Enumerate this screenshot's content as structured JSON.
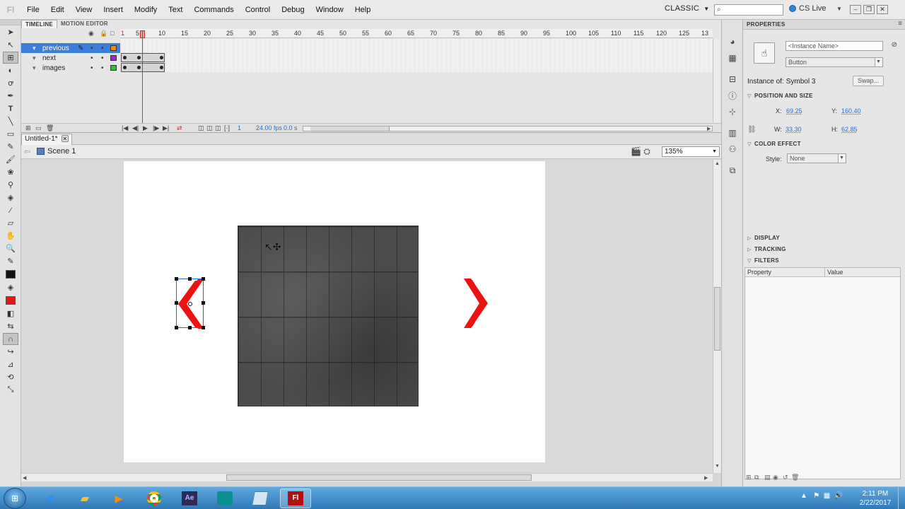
{
  "app": {
    "logo": "Fl"
  },
  "menu": [
    "File",
    "Edit",
    "View",
    "Insert",
    "Modify",
    "Text",
    "Commands",
    "Control",
    "Debug",
    "Window",
    "Help"
  ],
  "workspace": "CLASSIC",
  "search": {
    "placeholder": ""
  },
  "cs_live": "CS Live",
  "timeline": {
    "tabs": [
      "TIMELINE",
      "MOTION EDITOR"
    ],
    "frame_numbers": [
      "1",
      "5",
      "10",
      "15",
      "20",
      "25",
      "30",
      "35",
      "40",
      "45",
      "50",
      "55",
      "60",
      "65",
      "70",
      "75",
      "80",
      "85",
      "90",
      "95",
      "100",
      "105",
      "110",
      "115",
      "120",
      "125",
      "13"
    ],
    "layers": [
      {
        "name": "previous",
        "color": "#ff8000",
        "selected": true
      },
      {
        "name": "next",
        "color": "#a020f0",
        "selected": false
      },
      {
        "name": "images",
        "color": "#22cc22",
        "selected": false
      }
    ],
    "current_frame": "1",
    "fps": "24.00 fps",
    "elapsed": "0.0 s"
  },
  "document": {
    "tab": "Untitled-1*",
    "scene": "Scene 1",
    "zoom": "135%"
  },
  "properties": {
    "title": "PROPERTIES",
    "instance_name_placeholder": "<Instance Name>",
    "symbol_type": "Button",
    "instance_of_label": "Instance of:",
    "instance_of_value": "Symbol 3",
    "swap_label": "Swap...",
    "position_size_title": "POSITION AND SIZE",
    "x_label": "X:",
    "x_value": "69.25",
    "y_label": "Y:",
    "y_value": "160.40",
    "w_label": "W:",
    "w_value": "33.30",
    "h_label": "H:",
    "h_value": "62.85",
    "color_effect_title": "COLOR EFFECT",
    "style_label": "Style:",
    "style_value": "None",
    "display_title": "DISPLAY",
    "tracking_title": "TRACKING",
    "filters_title": "FILTERS",
    "filters_columns": [
      "Property",
      "Value"
    ]
  },
  "colors": {
    "arrow_red": "#ee1111",
    "stroke_color": "#111111",
    "fill_color": "#ee1111",
    "selection_blue": "#2a68c8"
  },
  "taskbar": {
    "apps": [
      "windows-explorer",
      "internet-explorer",
      "file-explorer",
      "media-player",
      "chrome",
      "after-effects",
      "app-teal",
      "app-notes",
      "flash"
    ],
    "time": "2:11 PM",
    "date": "2/22/2017"
  }
}
